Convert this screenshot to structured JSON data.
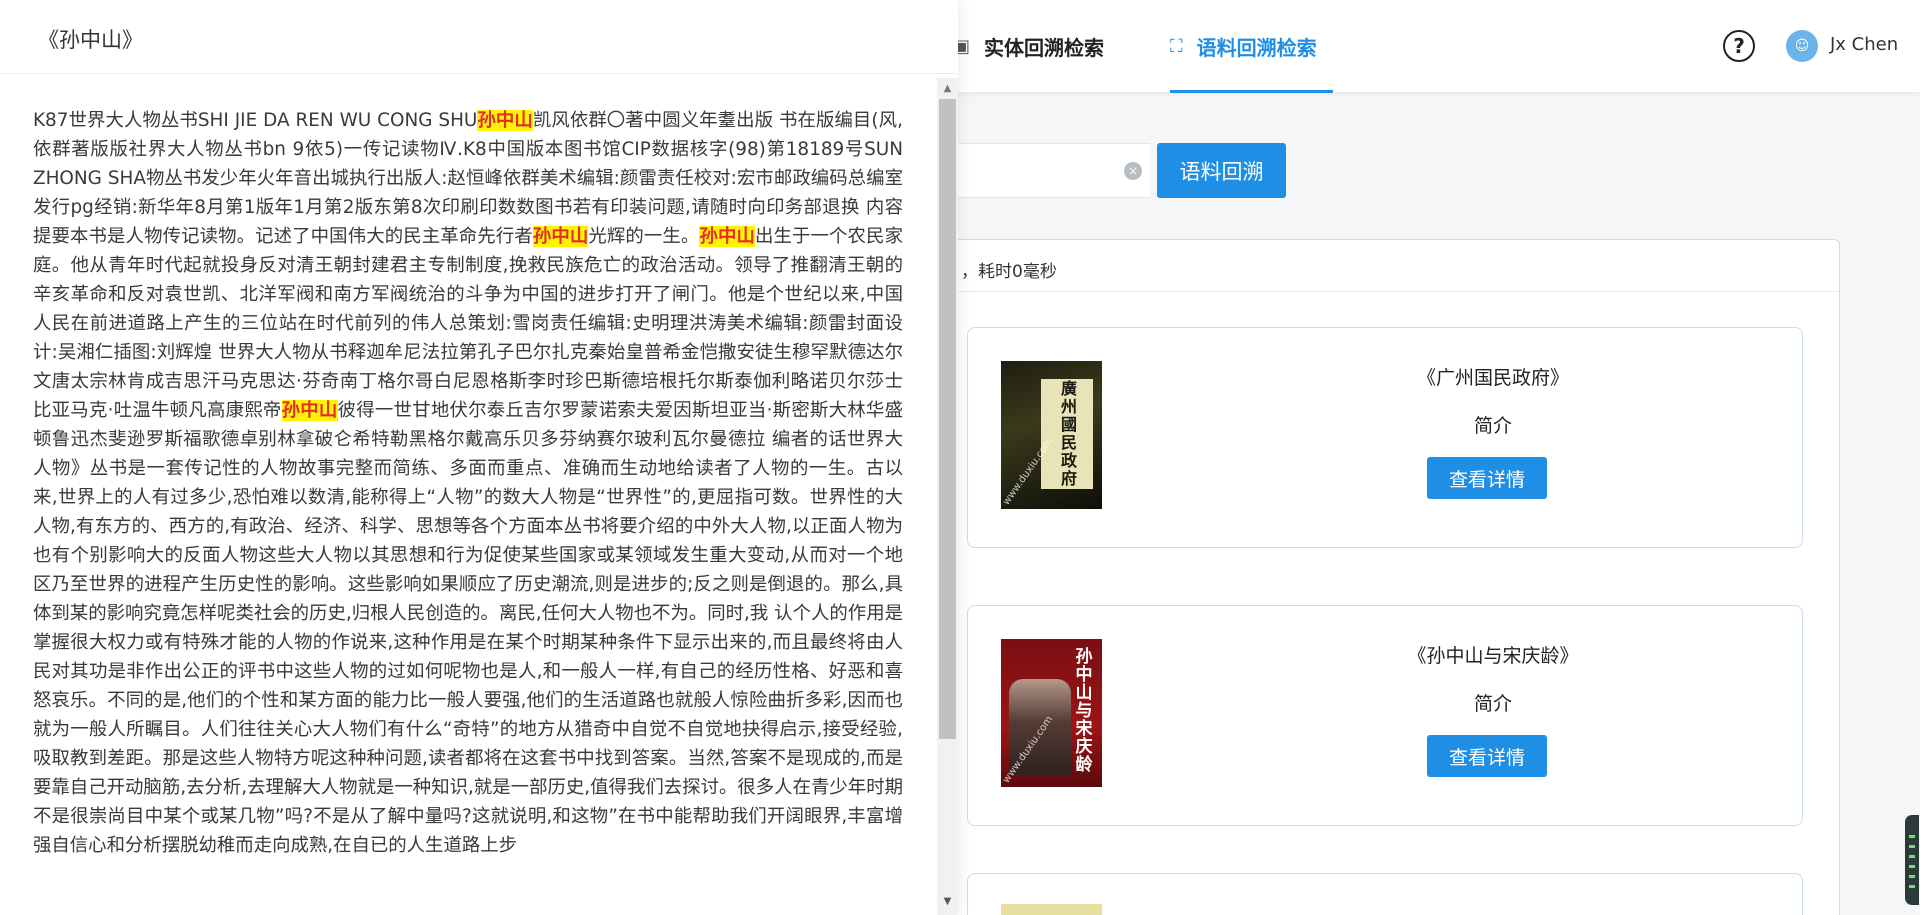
{
  "nav": {
    "tab_entity": "实体回溯检索",
    "tab_corpus": "语料回溯检索",
    "help_symbol": "?",
    "username": "Jx Chen"
  },
  "search": {
    "clear_symbol": "×",
    "button_label": "语料回溯"
  },
  "results": {
    "status_text": "，耗时0毫秒",
    "items": [
      {
        "title": "《广州国民政府》",
        "intro_label": "简介",
        "detail_label": "查看详情",
        "cover_title": "廣州國民政府",
        "cover_watermark": "www.duxiu.com"
      },
      {
        "title": "《孙中山与宋庆龄》",
        "intro_label": "简介",
        "detail_label": "查看详情",
        "cover_title": "孙中山与宋庆龄",
        "cover_watermark": "www.duxiu.com"
      }
    ]
  },
  "drawer": {
    "title": "《孙中山》",
    "segments": [
      {
        "text": "K87世界大人物丛书SHI JIE DA REN WU CONG SHU"
      },
      {
        "text": "孙中山",
        "highlight": true
      },
      {
        "text": "凯风依群〇著中圆义年耋出版 书在版编目(风,依群著版版社界大人物丛书bn 9依5)一传记读物Ⅳ.K8中国版本图书馆CIP数据核字(98)第18189号SUN ZHONG SHA物丛书发少年火年音出城执行出版人:赵恒峰依群美术编辑:颜雷责任校对:宏市邮政编码总编室发行pg经销:新华年8月第1版年1月第2版东第8次印刷印数数图书若有印装问题,请随时向印务部退换 内容提要本书是人物传记读物。记述了中国伟大的民主革命先行者"
      },
      {
        "text": "孙中山",
        "highlight": true
      },
      {
        "text": "光辉的一生。"
      },
      {
        "text": "孙中山",
        "highlight": true
      },
      {
        "text": "出生于一个农民家庭。他从青年时代起就投身反对清王朝封建君主专制制度,挽救民族危亡的政治活动。领导了推翻清王朝的辛亥革命和反对袁世凯、北洋军阀和南方军阀统治的斗争为中国的进步打开了闸门。他是个世纪以来,中国人民在前进道路上产生的三位站在时代前列的伟人总策划:雪岗责任编辑:史明理洪涛美术编辑:颜雷封面设计:吴湘仁插图:刘辉煌 世界大人物从书释迦牟尼法拉第孔子巴尔扎克秦始皇普希金恺撒安徒生穆罕默德达尔文唐太宗林肯成吉思汗马克思达·芬奇南丁格尔哥白尼恩格斯李时珍巴斯德培根托尔斯泰伽利略诺贝尔莎士比亚马克·吐温牛顿凡高康熙帝"
      },
      {
        "text": "孙中山",
        "highlight": true
      },
      {
        "text": "彼得一世甘地伏尔泰丘吉尔罗蒙诺索夫爱因斯坦亚当·斯密斯大林华盛顿鲁迅杰斐逊罗斯福歌德卓别林拿破仑希特勒黑格尔戴高乐贝多芬纳赛尔玻利瓦尔曼德拉 编者的话世界大人物》丛书是一套传记性的人物故事完整而简练、多面而重点、准确而生动地给读者了人物的一生。古以来,世界上的人有过多少,恐怕难以数清,能称得上“人物”的数大人物是“世界性”的,更屈指可数。世界性的大人物,有东方的、西方的,有政治、经济、科学、思想等各个方面本丛书将要介绍的中外大人物,以正面人物为也有个别影响大的反面人物这些大人物以其思想和行为促使某些国家或某领域发生重大变动,从而对一个地区乃至世界的进程产生历史性的影响。这些影响如果顺应了历史潮流,则是进步的;反之则是倒退的。那么,具体到某的影响究竟怎样呢类社会的历史,归根人民创造的。离民,任何大人物也不为。同时,我 认个人的作用是掌握很大权力或有特殊才能的人物的作说来,这种作用是在某个时期某种条件下显示出来的,而且最终将由人民对其功是非作出公正的评书中这些人物的过如何呢物也是人,和一般人一样,有自己的经历性格、好恶和喜怒哀乐。不同的是,他们的个性和某方面的能力比一般人要强,他们的生活道路也就般人惊险曲折多彩,因而也就为一般人所瞩目。人们往往关心大人物们有什么“奇特”的地方从猎奇中自觉不自觉地抉得启示,接受经验,吸取教到差距。那是这些人物特方呢这种种问题,读者都将在这套书中找到答案。当然,答案不是现成的,而是要靠自己开动脑筋,去分析,去理解大人物就是一种知识,就是一部历史,值得我们去探讨。很多人在青少年时期不是很崇尚目中某个或某几物”吗?不是从了解中量吗?这就说明,和这物”在书中能帮助我们开阔眼界,丰富增强自信心和分析摆脱幼稚而走向成熟,在自已的人生道路上步"
      }
    ]
  },
  "colors": {
    "accent": "#1f8fe6",
    "highlight_bg": "#fff300",
    "highlight_fg": "#e52b2b"
  }
}
